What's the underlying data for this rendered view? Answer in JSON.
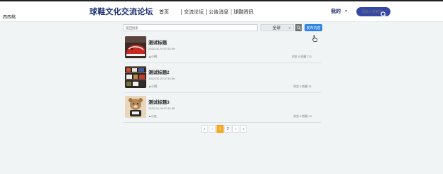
{
  "header": {
    "logo_text": "西西桃",
    "site_title": "球鞋文化交流论坛",
    "nav": [
      {
        "label": "首页"
      },
      {
        "label": "交流论坛"
      },
      {
        "label": "公告消息"
      },
      {
        "label": "球鞋资讯"
      }
    ],
    "me_label": "我的",
    "search_placeholder": "请输入搜索内容"
  },
  "filter": {
    "search_placeholder": "按回搜索",
    "select_value": "全部",
    "publish_label": "发布内容"
  },
  "posts": [
    {
      "title": "测试标题",
      "date": "2022-04-19 07:33:09",
      "author": "小明",
      "stats": "浏览 0   收藏 722",
      "image": "red-shoe-image"
    },
    {
      "title": "测试标题2",
      "date": "2022-04-19 07:33:09",
      "author": "小明",
      "stats": "浏览 0   收藏 31",
      "image": "sneaker-shelf-image"
    },
    {
      "title": "测试标题3",
      "date": "2022-04-19 07:33:09",
      "author": "小红",
      "stats": "浏览 0   收藏 43",
      "image": "plush-toy-image"
    }
  ],
  "pagination": {
    "items": [
      "«",
      "‹",
      "1",
      "2",
      "›",
      "»"
    ],
    "active": "1"
  },
  "colors": {
    "brand": "#1d2f74",
    "header_search": "#3548a6",
    "publish": "#2f84e0",
    "page_active": "#f5a623"
  }
}
